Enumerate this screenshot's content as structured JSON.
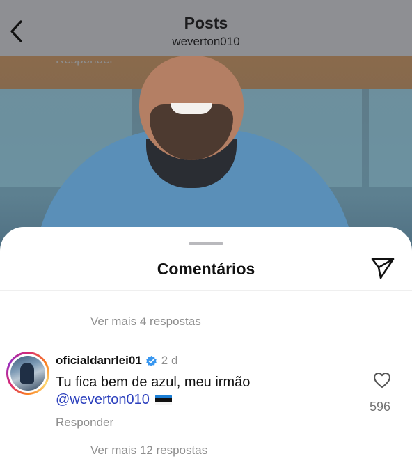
{
  "header": {
    "title": "Posts",
    "username": "weverton010",
    "back_icon": "chevron-left-icon"
  },
  "sheet": {
    "title": "Comentários",
    "share_icon": "paper-plane-icon"
  },
  "thread_top": {
    "reply_label_cut": "Responder",
    "more_replies": "Ver mais 4 respostas"
  },
  "comment": {
    "username": "oficialdanrlei01",
    "verified_icon": "verified-badge-icon",
    "time": "2 d",
    "text": "Tu fica bem de azul, meu irmão",
    "mention": "@weverton010",
    "flag_icon": "estonia-flag-icon",
    "like_icon": "heart-outline-icon",
    "likes": "596",
    "reply_label": "Responder",
    "more_replies": "Ver mais 12 respostas"
  },
  "colors": {
    "mention": "#2b3fbd",
    "muted": "#8e8e8e",
    "verified": "#3897f0"
  }
}
